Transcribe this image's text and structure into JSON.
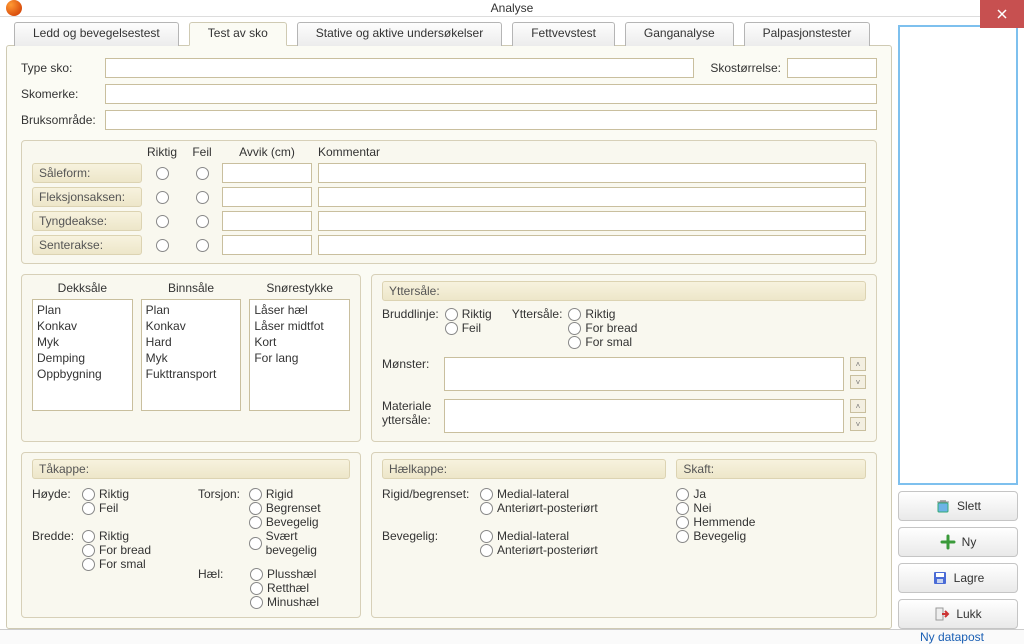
{
  "window": {
    "title": "Analyse"
  },
  "tabs": [
    "Ledd og bevegelsestest",
    "Test av sko",
    "Stative og aktive undersøkelser",
    "Fettvevstest",
    "Ganganalyse",
    "Palpasjonstester"
  ],
  "active_tab": 1,
  "top_fields": {
    "type_sko_label": "Type sko:",
    "skostorrelse_label": "Skostørrelse:",
    "skomerke_label": "Skomerke:",
    "bruksomrade_label": "Bruksområde:",
    "type_sko": "",
    "skostorrelse": "",
    "skomerke": "",
    "bruksomrade": ""
  },
  "test_grid": {
    "col_riktig": "Riktig",
    "col_feil": "Feil",
    "col_avvik": "Avvik (cm)",
    "col_komm": "Kommentar",
    "rows": [
      {
        "label": "Såleform:",
        "avvik": "",
        "komm": ""
      },
      {
        "label": "Fleksjonsaksen:",
        "avvik": "",
        "komm": ""
      },
      {
        "label": "Tyngdeakse:",
        "avvik": "",
        "komm": ""
      },
      {
        "label": "Senterakse:",
        "avvik": "",
        "komm": ""
      }
    ]
  },
  "lists": {
    "dekksale_label": "Dekksåle",
    "binnsale_label": "Binnsåle",
    "snorestykke_label": "Snørestykke",
    "dekksale": [
      "Plan",
      "Konkav",
      "Myk",
      "Demping",
      "Oppbygning"
    ],
    "binnsale": [
      "Plan",
      "Konkav",
      "Hard",
      "Myk",
      "Fukttransport"
    ],
    "snorestykke": [
      "Låser hæl",
      "Låser midtfot",
      "Kort",
      "For lang"
    ]
  },
  "yttersale": {
    "title": "Yttersåle:",
    "bruddlinje_label": "Bruddlinje:",
    "bruddlinje_opts": [
      "Riktig",
      "Feil"
    ],
    "ytter_label": "Yttersåle:",
    "ytter_opts": [
      "Riktig",
      "For bread",
      "For smal"
    ],
    "monster_label": "Mønster:",
    "materiale_label": "Materiale yttersåle:",
    "monster": "",
    "materiale": ""
  },
  "takappe": {
    "title": "Tåkappe:",
    "hoyde_label": "Høyde:",
    "hoyde_opts": [
      "Riktig",
      "Feil"
    ],
    "bredde_label": "Bredde:",
    "bredde_opts": [
      "Riktig",
      "For bread",
      "For smal"
    ],
    "torsjon_label": "Torsjon:",
    "torsjon_opts": [
      "Rigid",
      "Begrenset",
      "Bevegelig",
      "Svært bevegelig"
    ],
    "hael_label": "Hæl:",
    "hael_opts": [
      "Plusshæl",
      "Retthæl",
      "Minushæl"
    ]
  },
  "haelkappe": {
    "title": "Hælkappe:",
    "rigid_label": "Rigid/begrenset:",
    "rigid_opts": [
      "Medial-lateral",
      "Anteriørt-posteriørt"
    ],
    "bevegelig_label": "Bevegelig:",
    "bevegelig_opts": [
      "Medial-lateral",
      "Anteriørt-posteriørt"
    ]
  },
  "skaft": {
    "title": "Skaft:",
    "opts": [
      "Ja",
      "Nei",
      "Hemmende",
      "Bevegelig"
    ]
  },
  "buttons": {
    "slett": "Slett",
    "ny": "Ny",
    "lagre": "Lagre",
    "lukk": "Lukk"
  },
  "status": "Ny datapost"
}
